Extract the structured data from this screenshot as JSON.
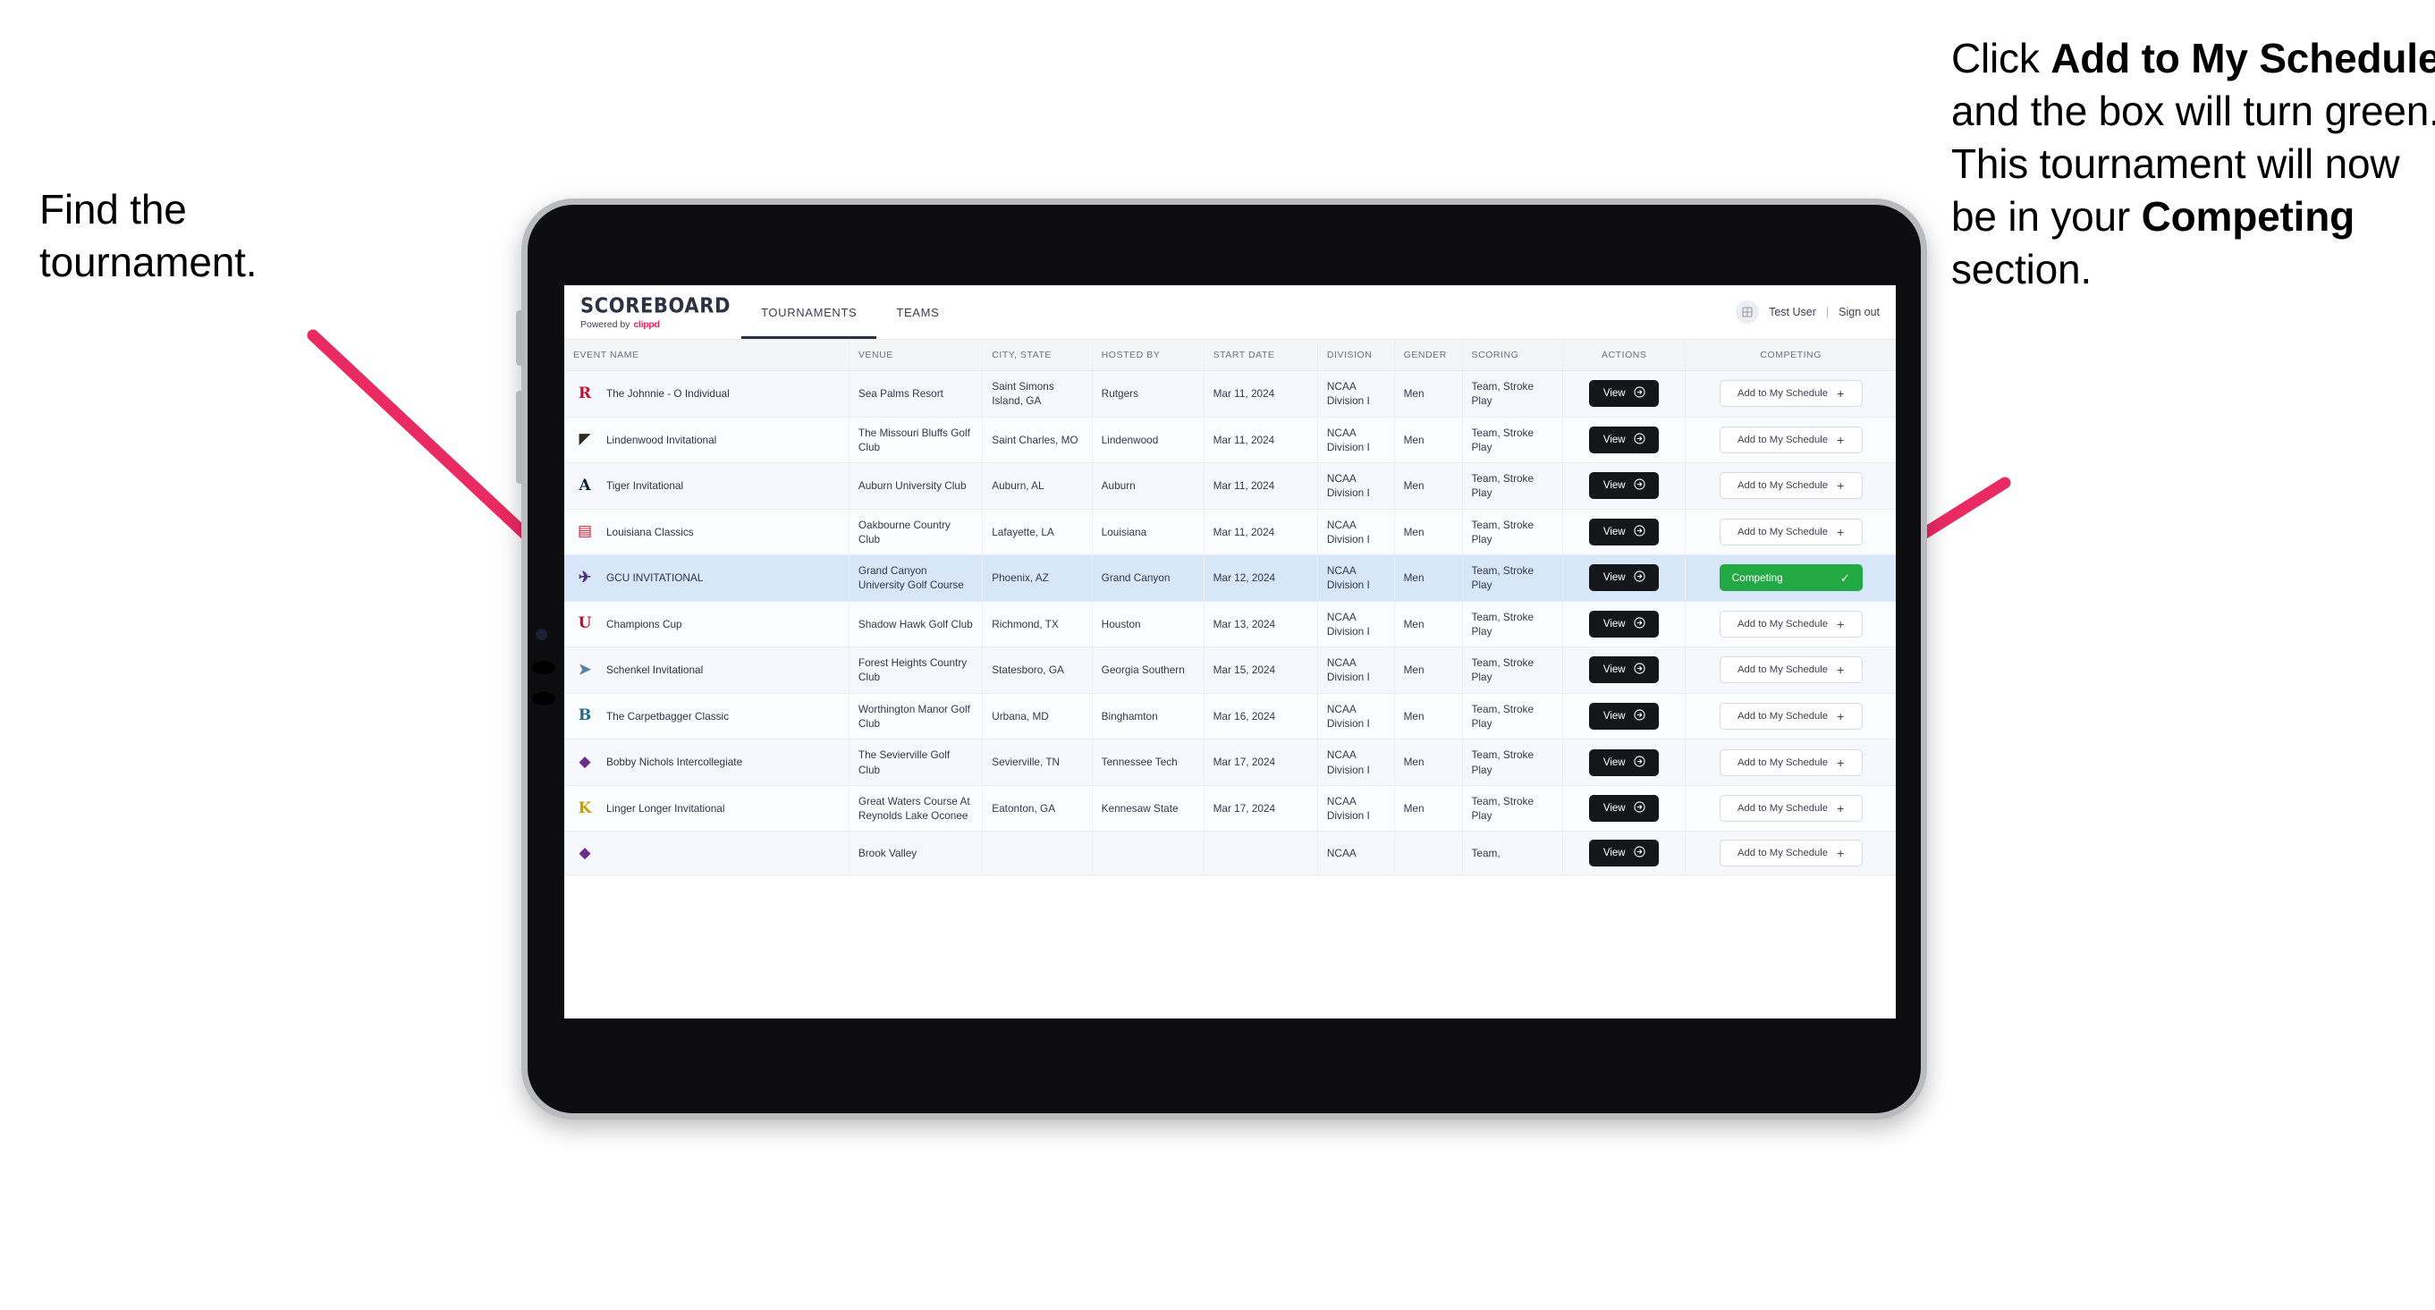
{
  "annotations": {
    "left": {
      "line1": "Find the",
      "line2": "tournament."
    },
    "right": {
      "p1_prefix": "Click ",
      "p1_bold": "Add to My Schedule",
      "p1_suffix": " and the box will turn green. This tournament will now be in your ",
      "p2_bold": "Competing",
      "p2_suffix": " section."
    },
    "arrow_color": "#ea2a62"
  },
  "app": {
    "brand": {
      "title": "SCOREBOARD",
      "powered_prefix": "Powered by",
      "powered_brand": "clippd",
      "brand_color": "#f0225a"
    },
    "tabs": [
      {
        "label": "TOURNAMENTS",
        "active": true
      },
      {
        "label": "TEAMS",
        "active": false
      }
    ],
    "user": {
      "avatar_icon": "user-grid-icon",
      "name": "Test User",
      "separator": "|",
      "signout": "Sign out"
    }
  },
  "table": {
    "columns": [
      "EVENT NAME",
      "VENUE",
      "CITY, STATE",
      "HOSTED BY",
      "START DATE",
      "DIVISION",
      "GENDER",
      "SCORING",
      "ACTIONS",
      "COMPETING"
    ],
    "action_labels": {
      "view": "View",
      "view_icon": "arrow-circle-right-icon",
      "add": "Add to My Schedule",
      "add_icon": "plus-icon",
      "competing": "Competing",
      "competing_icon": "check-icon",
      "competing_color": "#22a944"
    },
    "rows": [
      {
        "logo_text": "R",
        "logo_color": "#c8102e",
        "event": "The Johnnie - O Individual",
        "venue": "Sea Palms Resort",
        "city": "Saint Simons Island, GA",
        "host": "Rutgers",
        "date": "Mar 11, 2024",
        "division": "NCAA Division I",
        "gender": "Men",
        "scoring": "Team, Stroke Play",
        "competing": false,
        "selected": false
      },
      {
        "logo_text": "◤",
        "logo_color": "#2e2a1c",
        "event": "Lindenwood Invitational",
        "venue": "The Missouri Bluffs Golf Club",
        "city": "Saint Charles, MO",
        "host": "Lindenwood",
        "date": "Mar 11, 2024",
        "division": "NCAA Division I",
        "gender": "Men",
        "scoring": "Team, Stroke Play",
        "competing": false,
        "selected": false
      },
      {
        "logo_text": "A",
        "logo_color": "#0c2340",
        "event": "Tiger Invitational",
        "venue": "Auburn University Club",
        "city": "Auburn, AL",
        "host": "Auburn",
        "date": "Mar 11, 2024",
        "division": "NCAA Division I",
        "gender": "Men",
        "scoring": "Team, Stroke Play",
        "competing": false,
        "selected": false
      },
      {
        "logo_text": "▤",
        "logo_color": "#ce1126",
        "event": "Louisiana Classics",
        "venue": "Oakbourne Country Club",
        "city": "Lafayette, LA",
        "host": "Louisiana",
        "date": "Mar 11, 2024",
        "division": "NCAA Division I",
        "gender": "Men",
        "scoring": "Team, Stroke Play",
        "competing": false,
        "selected": false
      },
      {
        "logo_text": "✈",
        "logo_color": "#4f2d7f",
        "event": "GCU INVITATIONAL",
        "venue": "Grand Canyon University Golf Course",
        "city": "Phoenix, AZ",
        "host": "Grand Canyon",
        "date": "Mar 12, 2024",
        "division": "NCAA Division I",
        "gender": "Men",
        "scoring": "Team, Stroke Play",
        "competing": true,
        "selected": true
      },
      {
        "logo_text": "U",
        "logo_color": "#c8102e",
        "event": "Champions Cup",
        "venue": "Shadow Hawk Golf Club",
        "city": "Richmond, TX",
        "host": "Houston",
        "date": "Mar 13, 2024",
        "division": "NCAA Division I",
        "gender": "Men",
        "scoring": "Team, Stroke Play",
        "competing": false,
        "selected": false
      },
      {
        "logo_text": "➤",
        "logo_color": "#5b7fa6",
        "event": "Schenkel Invitational",
        "venue": "Forest Heights Country Club",
        "city": "Statesboro, GA",
        "host": "Georgia Southern",
        "date": "Mar 15, 2024",
        "division": "NCAA Division I",
        "gender": "Men",
        "scoring": "Team, Stroke Play",
        "competing": false,
        "selected": false
      },
      {
        "logo_text": "B",
        "logo_color": "#1d6a8c",
        "event": "The Carpetbagger Classic",
        "venue": "Worthington Manor Golf Club",
        "city": "Urbana, MD",
        "host": "Binghamton",
        "date": "Mar 16, 2024",
        "division": "NCAA Division I",
        "gender": "Men",
        "scoring": "Team, Stroke Play",
        "competing": false,
        "selected": false
      },
      {
        "logo_text": "◆",
        "logo_color": "#6b2d8c",
        "event": "Bobby Nichols Intercollegiate",
        "venue": "The Sevierville Golf Club",
        "city": "Sevierville, TN",
        "host": "Tennessee Tech",
        "date": "Mar 17, 2024",
        "division": "NCAA Division I",
        "gender": "Men",
        "scoring": "Team, Stroke Play",
        "competing": false,
        "selected": false
      },
      {
        "logo_text": "K",
        "logo_color": "#c6a000",
        "event": "Linger Longer Invitational",
        "venue": "Great Waters Course At Reynolds Lake Oconee",
        "city": "Eatonton, GA",
        "host": "Kennesaw State",
        "date": "Mar 17, 2024",
        "division": "NCAA Division I",
        "gender": "Men",
        "scoring": "Team, Stroke Play",
        "competing": false,
        "selected": false
      },
      {
        "logo_text": "◆",
        "logo_color": "#6b2d8c",
        "event": "",
        "venue": "Brook Valley",
        "city": "",
        "host": "",
        "date": "",
        "division": "NCAA",
        "gender": "",
        "scoring": "Team,",
        "competing": false,
        "selected": false
      }
    ]
  }
}
